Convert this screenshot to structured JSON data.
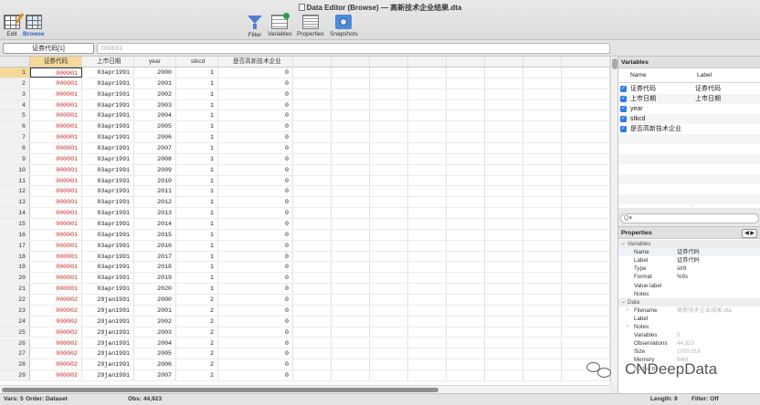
{
  "window": {
    "title": "Data Editor (Browse) — 高新技术企业结果.dta"
  },
  "toolbar": {
    "edit": "Edit",
    "browse": "Browse",
    "filter": "Filter",
    "variables": "Variables",
    "properties": "Properties",
    "snapshots": "Snapshots"
  },
  "command": {
    "variable": "证券代码[1]",
    "value_placeholder": "000001"
  },
  "grid": {
    "columns": [
      "证券代码",
      "上市日期",
      "year",
      "stkcd",
      "是否高新技术企业"
    ],
    "rows": [
      [
        "1",
        "000001",
        "03apr1991",
        "2000",
        "1",
        "0"
      ],
      [
        "2",
        "000001",
        "03apr1991",
        "2001",
        "1",
        "0"
      ],
      [
        "3",
        "000001",
        "03apr1991",
        "2002",
        "1",
        "0"
      ],
      [
        "4",
        "000001",
        "03apr1991",
        "2003",
        "1",
        "0"
      ],
      [
        "5",
        "000001",
        "03apr1991",
        "2004",
        "1",
        "0"
      ],
      [
        "6",
        "000001",
        "03apr1991",
        "2005",
        "1",
        "0"
      ],
      [
        "7",
        "000001",
        "03apr1991",
        "2006",
        "1",
        "0"
      ],
      [
        "8",
        "000001",
        "03apr1991",
        "2007",
        "1",
        "0"
      ],
      [
        "9",
        "000001",
        "03apr1991",
        "2008",
        "1",
        "0"
      ],
      [
        "10",
        "000001",
        "03apr1991",
        "2009",
        "1",
        "0"
      ],
      [
        "11",
        "000001",
        "03apr1991",
        "2010",
        "1",
        "0"
      ],
      [
        "12",
        "000001",
        "03apr1991",
        "2011",
        "1",
        "0"
      ],
      [
        "13",
        "000001",
        "03apr1991",
        "2012",
        "1",
        "0"
      ],
      [
        "14",
        "000001",
        "03apr1991",
        "2013",
        "1",
        "0"
      ],
      [
        "15",
        "000001",
        "03apr1991",
        "2014",
        "1",
        "0"
      ],
      [
        "16",
        "000001",
        "03apr1991",
        "2015",
        "1",
        "0"
      ],
      [
        "17",
        "000001",
        "03apr1991",
        "2016",
        "1",
        "0"
      ],
      [
        "18",
        "000001",
        "03apr1991",
        "2017",
        "1",
        "0"
      ],
      [
        "19",
        "000001",
        "03apr1991",
        "2018",
        "1",
        "0"
      ],
      [
        "20",
        "000001",
        "03apr1991",
        "2019",
        "1",
        "0"
      ],
      [
        "21",
        "000001",
        "03apr1991",
        "2020",
        "1",
        "0"
      ],
      [
        "22",
        "000002",
        "29jan1991",
        "2000",
        "2",
        "0"
      ],
      [
        "23",
        "000002",
        "29jan1991",
        "2001",
        "2",
        "0"
      ],
      [
        "24",
        "000002",
        "29jan1991",
        "2002",
        "2",
        "0"
      ],
      [
        "25",
        "000002",
        "29jan1991",
        "2003",
        "2",
        "0"
      ],
      [
        "26",
        "000002",
        "29jan1991",
        "2004",
        "2",
        "0"
      ],
      [
        "27",
        "000002",
        "29jan1991",
        "2005",
        "2",
        "0"
      ],
      [
        "28",
        "000002",
        "29jan1991",
        "2006",
        "2",
        "0"
      ],
      [
        "29",
        "000002",
        "29jan1991",
        "2007",
        "2",
        "0"
      ]
    ]
  },
  "variables_panel": {
    "title": "Variables",
    "col_name": "Name",
    "col_label": "Label",
    "items": [
      {
        "name": "证券代码",
        "label": "证券代码"
      },
      {
        "name": "上市日期",
        "label": "上市日期"
      },
      {
        "name": "year",
        "label": ""
      },
      {
        "name": "stkcd",
        "label": ""
      },
      {
        "name": "是否高新技术企业",
        "label": ""
      }
    ],
    "search_glyph": "Q▾"
  },
  "properties_panel": {
    "title": "Properties",
    "nav": "◀ ▶",
    "variables_group": "Variables",
    "variables": [
      {
        "key": "Name",
        "value": "证券代码"
      },
      {
        "key": "Label",
        "value": "证券代码"
      },
      {
        "key": "Type",
        "value": "str9"
      },
      {
        "key": "Format",
        "value": "%9s"
      },
      {
        "key": "Value label",
        "value": ""
      },
      {
        "key": "Notes",
        "value": ""
      }
    ],
    "data_group": "Data",
    "data": [
      {
        "key": "Filename",
        "value": "高新技术企业结果.dta"
      },
      {
        "key": "Label",
        "value": ""
      },
      {
        "key": "Notes",
        "value": ""
      },
      {
        "key": "Variables",
        "value": "5"
      },
      {
        "key": "Observations",
        "value": "44,923"
      },
      {
        "key": "Size",
        "value": "1009.01K"
      },
      {
        "key": "Memory",
        "value": "64M"
      },
      {
        "key": "Sorted by",
        "value": ""
      }
    ]
  },
  "watermark": {
    "text": "CNDeepData"
  },
  "status": {
    "vars": "Vars: 5",
    "order": "Order: Dataset",
    "obs": "Obs: 44,923",
    "length": "Length: 9",
    "filter": "Filter: Off"
  }
}
